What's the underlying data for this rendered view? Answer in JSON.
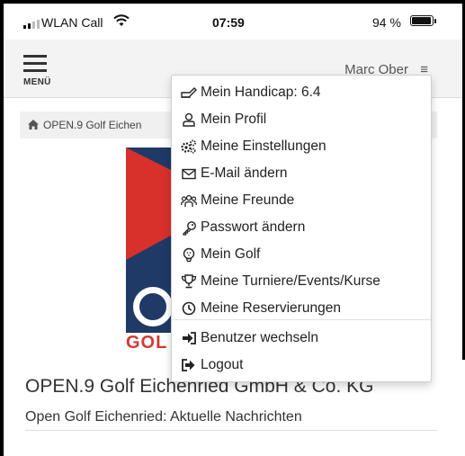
{
  "status_bar": {
    "carrier": "WLAN Call",
    "time": "07:59",
    "battery_percent": "94 %",
    "battery_level": 0.94
  },
  "header": {
    "menu_label": "MENÜ",
    "user_name": "Marc Ober",
    "user_menu_glyph": "≡"
  },
  "breadcrumb": {
    "text": "OPEN.9 Golf Eichen"
  },
  "logo": {
    "text": "GOL"
  },
  "main": {
    "company_title": "OPEN.9 Golf Eichenried GmbH & Co. KG",
    "news_title": "Open Golf Eichenried: Aktuelle Nachrichten"
  },
  "dropdown": {
    "items": [
      {
        "label": "Mein Handicap: 6.4",
        "icon": "pencil-icon"
      },
      {
        "label": "Mein Profil",
        "icon": "user-icon"
      },
      {
        "label": "Meine Einstellungen",
        "icon": "gears-icon"
      },
      {
        "label": "E-Mail ändern",
        "icon": "envelope-icon"
      },
      {
        "label": "Meine Freunde",
        "icon": "users-icon"
      },
      {
        "label": "Passwort ändern",
        "icon": "key-icon"
      },
      {
        "label": "Mein Golf",
        "icon": "golf-ball-icon"
      },
      {
        "label": "Meine Turniere/Events/Kurse",
        "icon": "trophy-icon"
      },
      {
        "label": "Meine Reservierungen",
        "icon": "clock-icon"
      },
      {
        "label": "Benutzer wechseln",
        "icon": "sign-in-icon"
      },
      {
        "label": "Logout",
        "icon": "sign-out-icon"
      }
    ]
  },
  "colors": {
    "logo_navy": "#1f3a66",
    "logo_red": "#d8302b",
    "logo_text_red": "#d23a34",
    "header_bg": "#f3f3f3"
  }
}
